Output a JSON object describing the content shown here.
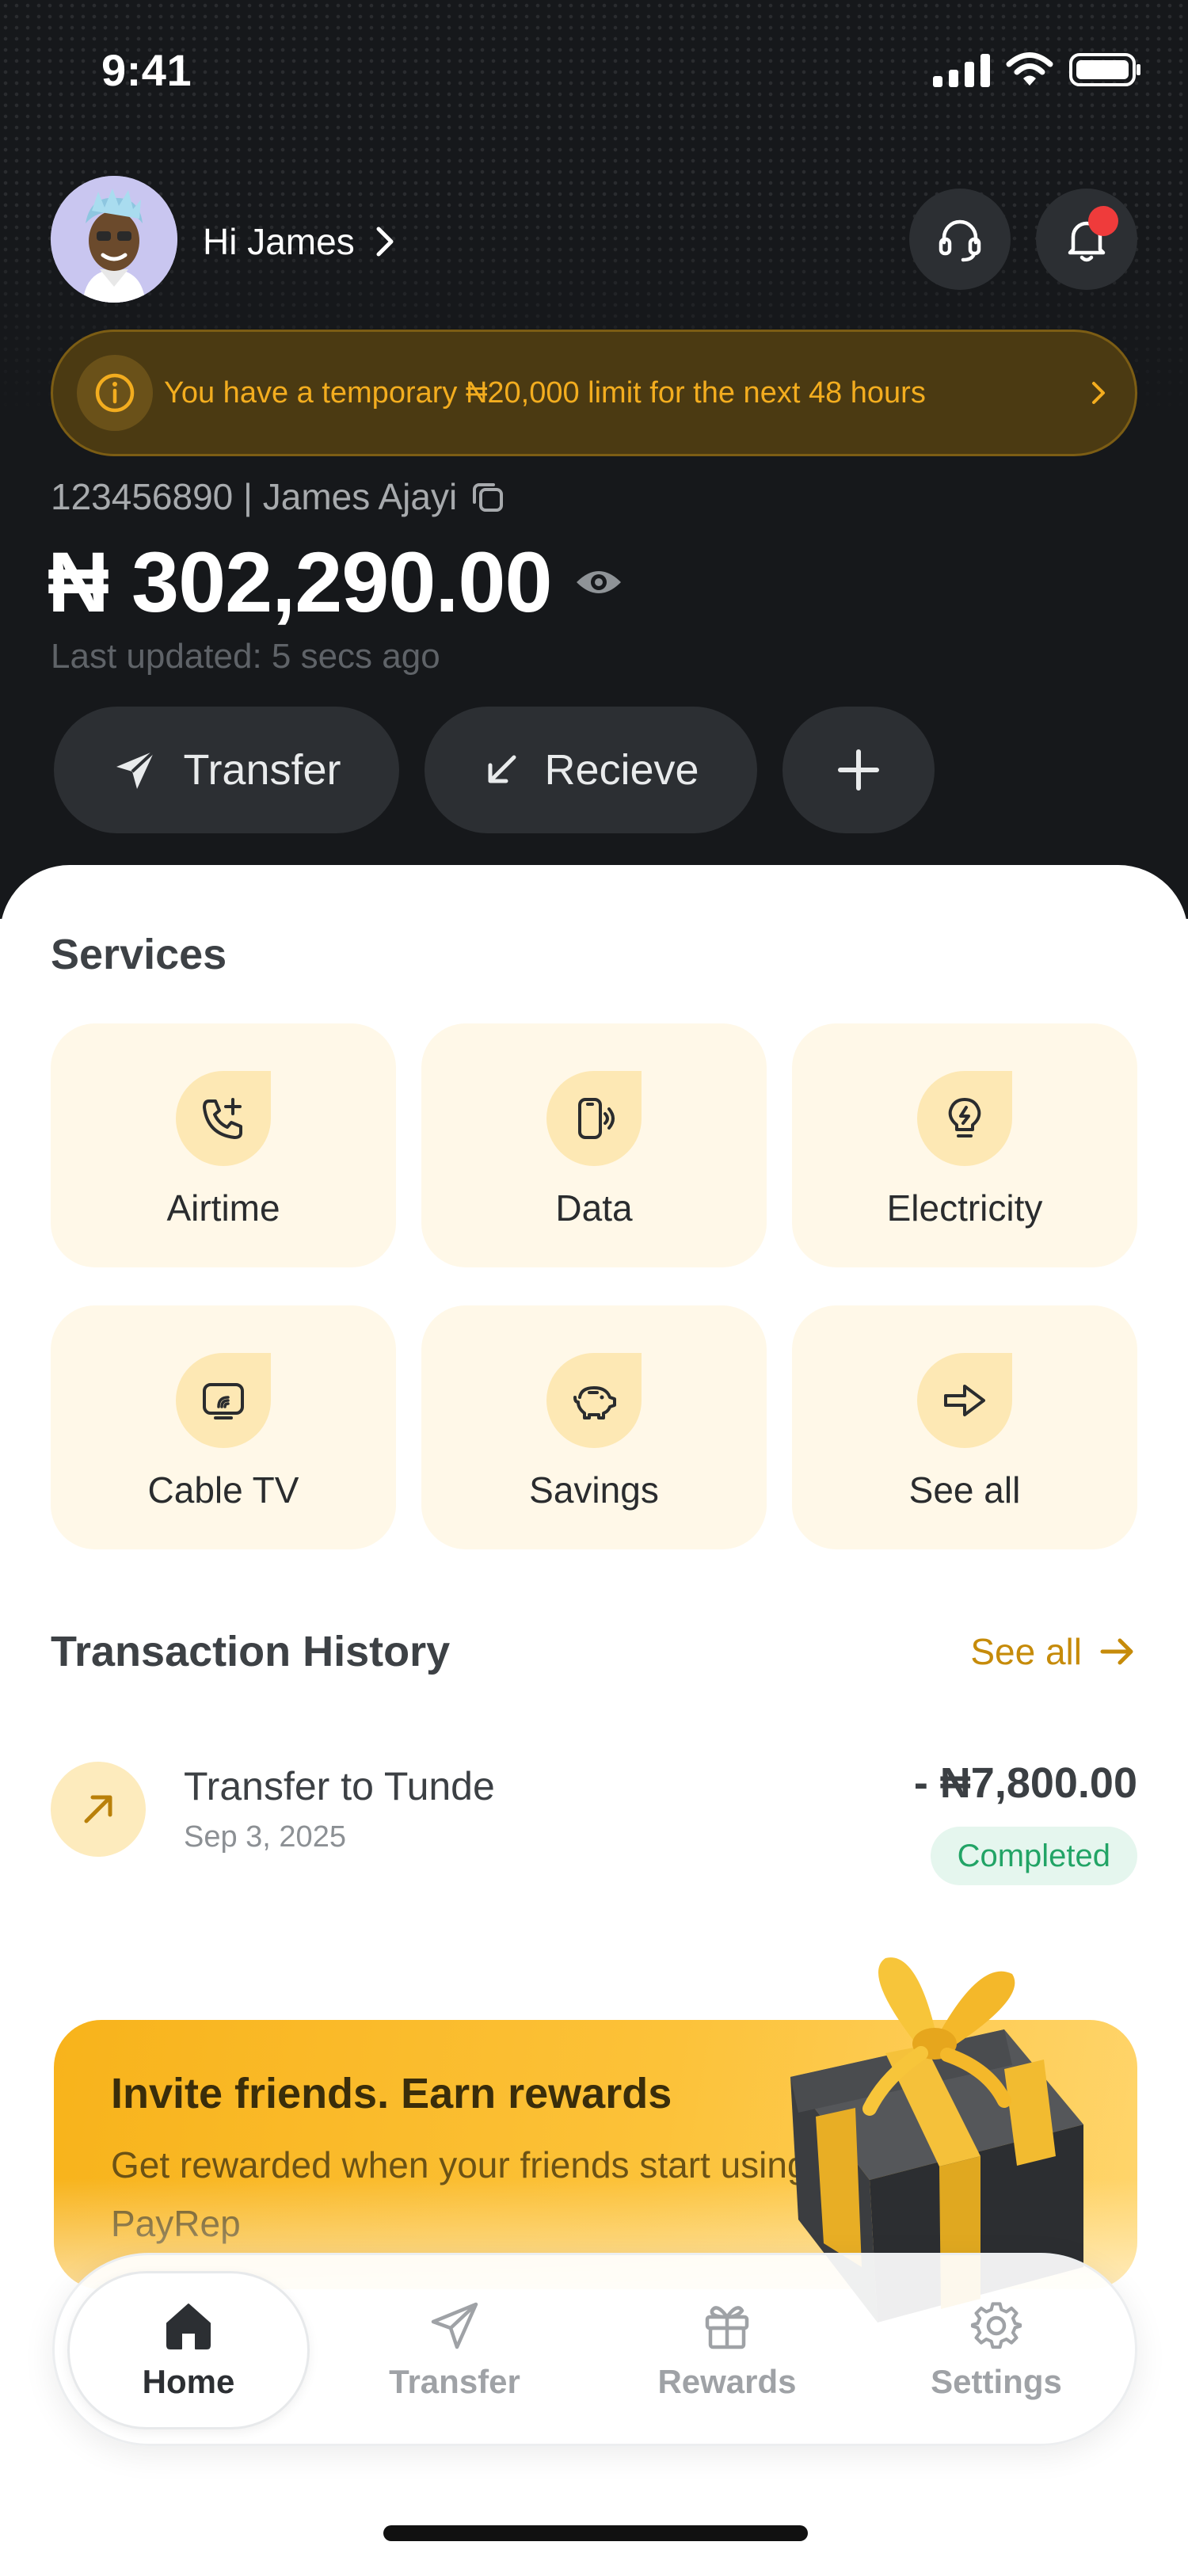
{
  "status_bar": {
    "time": "9:41"
  },
  "header": {
    "greeting": "Hi James",
    "limit_banner": "You have a temporary ₦20,000 limit for the next 48 hours",
    "account_line": "123456890 | James Ajayi",
    "balance": "₦ 302,290.00",
    "last_updated": "Last updated: 5 secs ago",
    "actions": {
      "transfer": "Transfer",
      "receive": "Recieve"
    }
  },
  "services": {
    "title": "Services",
    "items": [
      {
        "label": "Airtime",
        "icon": "phone-plus-icon"
      },
      {
        "label": "Data",
        "icon": "mobile-data-icon"
      },
      {
        "label": "Electricity",
        "icon": "bulb-icon"
      },
      {
        "label": "Cable TV",
        "icon": "tv-icon"
      },
      {
        "label": "Savings",
        "icon": "piggy-bank-icon"
      },
      {
        "label": "See all",
        "icon": "arrow-right-icon"
      }
    ]
  },
  "history": {
    "title": "Transaction History",
    "see_all": "See all",
    "transactions": [
      {
        "title": "Transfer to Tunde",
        "date": "Sep 3, 2025",
        "amount": "- ₦7,800.00",
        "status": "Completed"
      }
    ]
  },
  "invite": {
    "title": "Invite friends. Earn rewards",
    "subtitle": "Get rewarded when your friends start using PayRep"
  },
  "nav": {
    "items": [
      {
        "label": "Home",
        "active": true
      },
      {
        "label": "Transfer",
        "active": false
      },
      {
        "label": "Rewards",
        "active": false
      },
      {
        "label": "Settings",
        "active": false
      }
    ]
  },
  "colors": {
    "header_bg": "#16181b",
    "accent": "#c68b0a",
    "banner_text": "#f3ad1f",
    "tile_bg": "#fff8e8",
    "success": "#22a466",
    "notification": "#ef3b3b"
  }
}
